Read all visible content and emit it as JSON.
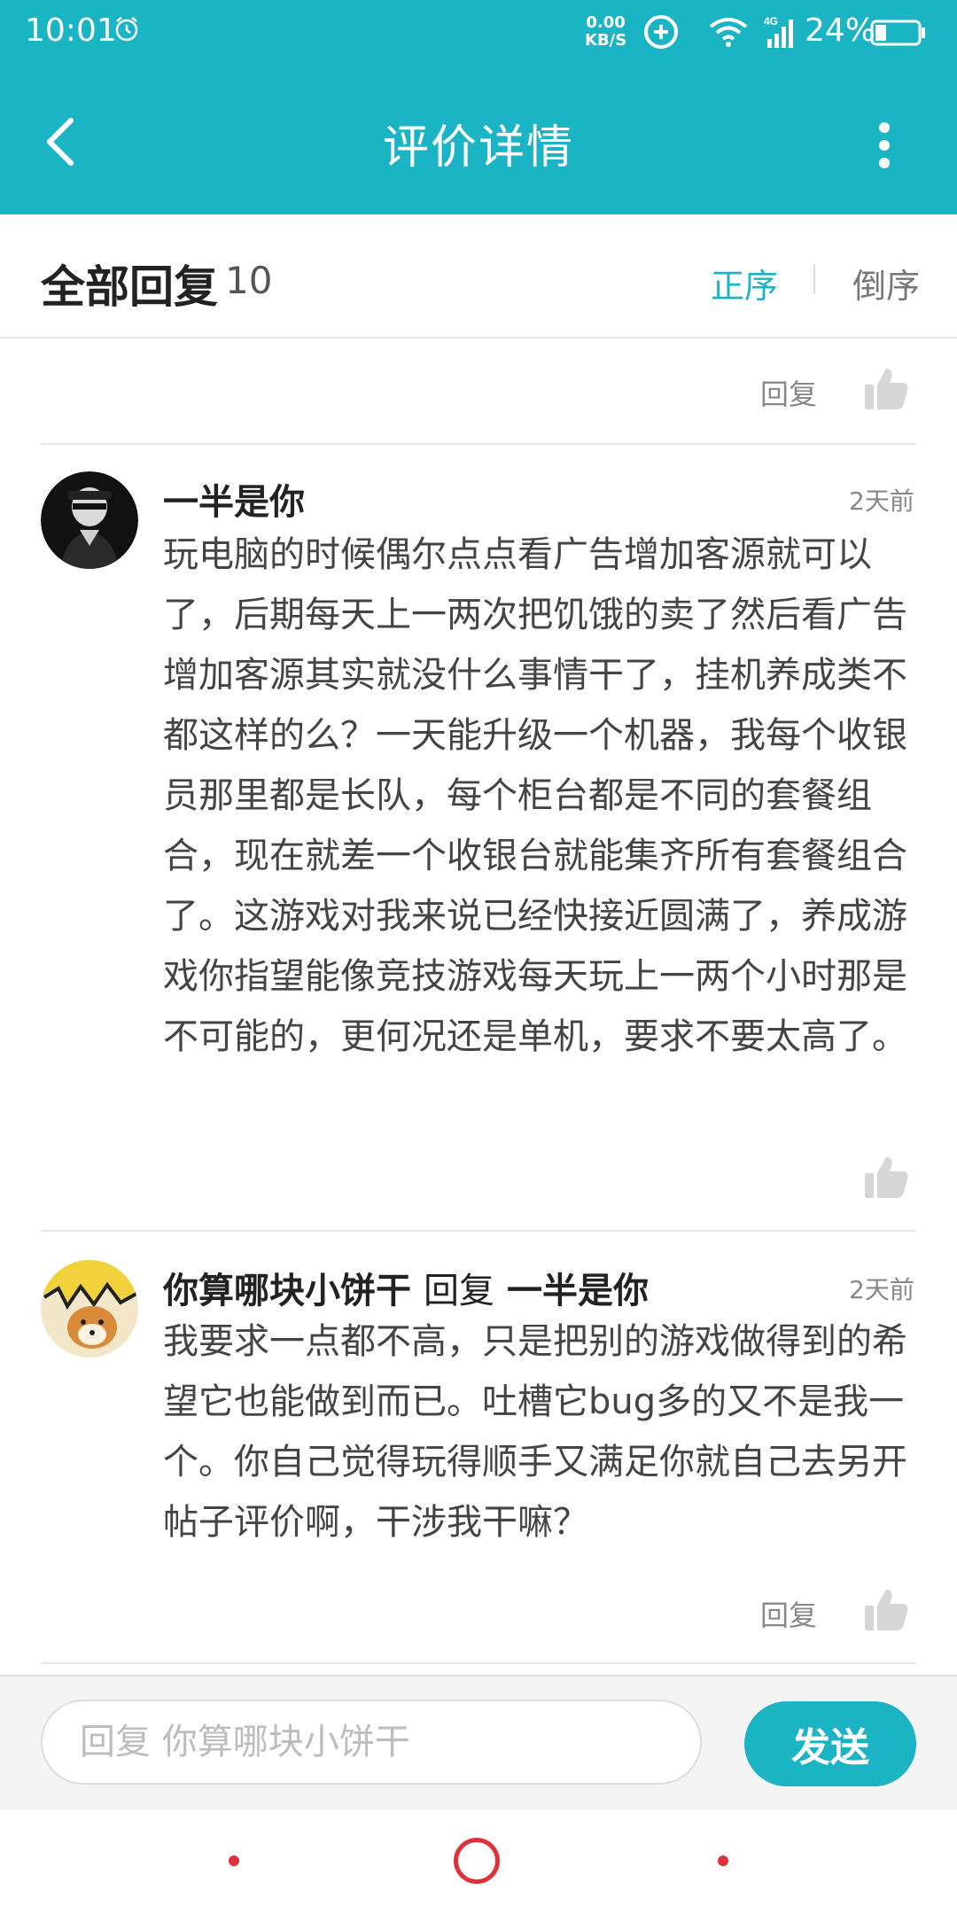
{
  "status_bar": {
    "time": "10:01",
    "net_speed_value": "0.00",
    "net_speed_unit": "KB/S",
    "network": "4G",
    "battery": "24%"
  },
  "header": {
    "title": "评价详情",
    "back_icon": "chevron-left-icon",
    "more_icon": "more-vertical-icon"
  },
  "replies": {
    "title": "全部回复",
    "count": "10",
    "sort_asc": "正序",
    "sort_desc": "倒序"
  },
  "actions": {
    "reply_label": "回复"
  },
  "comments": [
    {
      "author": "一半是你",
      "time": "2天前",
      "text": "玩电脑的时候偶尔点点看广告增加客源就可以了，后期每天上一两次把饥饿的卖了然后看广告增加客源其实就没什么事情干了，挂机养成类不都这样的么？一天能升级一个机器，我每个收银员那里都是长队，每个柜台都是不同的套餐组合，现在就差一个收银台就能集齐所有套餐组合了。这游戏对我来说已经快接近圆满了，养成游戏你指望能像竞技游戏每天玩上一两个小时那是不可能的，更何况还是单机，要求不要太高了。"
    },
    {
      "author": "你算哪块小饼干",
      "reply_word": "回复",
      "reply_to": "一半是你",
      "time": "2天前",
      "text": "我要求一点都不高，只是把别的游戏做得到的希望它也能做到而已。吐槽它bug多的又不是我一个。你自己觉得玩得顺手又满足你就自己去另开帖子评价啊，干涉我干嘛？"
    }
  ],
  "composer": {
    "placeholder": "回复 你算哪块小饼干",
    "value": "",
    "send_label": "发送"
  },
  "colors": {
    "accent": "#1ab4c4",
    "nav": "#e0303a"
  }
}
